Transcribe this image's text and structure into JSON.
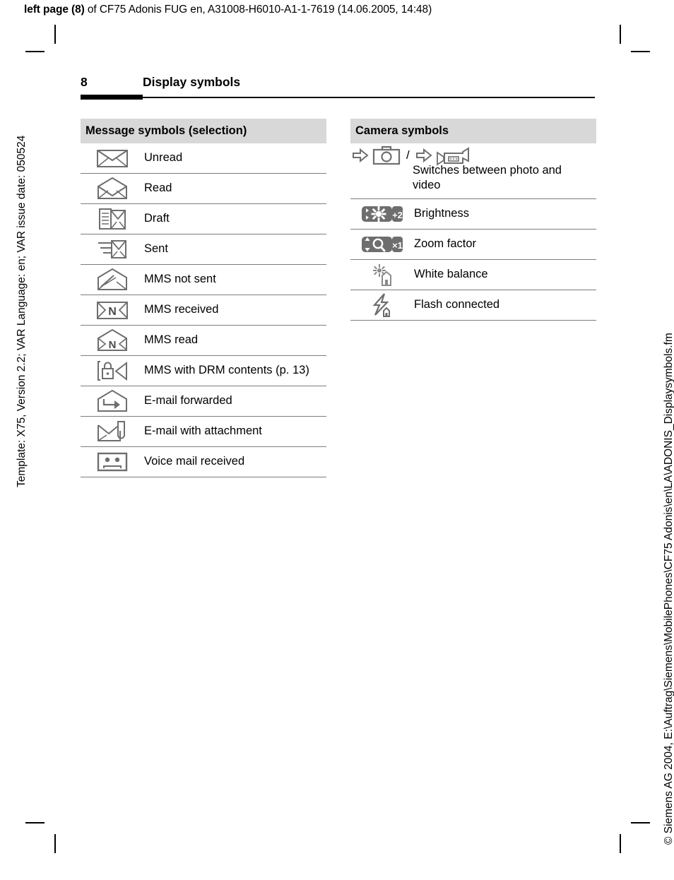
{
  "running_header": {
    "bold_prefix": "left page (8)",
    "rest": " of CF75 Adonis FUG en, A31008-H6010-A1-1-7619 (14.06.2005, 14:48)"
  },
  "side_text": {
    "left": "Template: X75, Version 2.2; VAR Language: en; VAR issue date: 050524",
    "right": "© Siemens AG 2004, E:\\Auftrag\\Siemens\\MobilePhones\\CF75 Adonis\\en\\LA\\ADONIS_Displaysymbols.fm"
  },
  "title": {
    "page_number": "8",
    "heading": "Display symbols"
  },
  "tables": [
    {
      "id": "message",
      "header": "Message symbols (selection)",
      "rows": [
        {
          "icon": "envelope-closed-icon",
          "label": "Unread"
        },
        {
          "icon": "envelope-open-icon",
          "label": "Read"
        },
        {
          "icon": "envelope-draft-icon",
          "label": "Draft"
        },
        {
          "icon": "envelope-sent-icon",
          "label": "Sent"
        },
        {
          "icon": "mms-not-sent-icon",
          "label": "MMS not sent"
        },
        {
          "icon": "mms-received-icon",
          "label": "MMS received"
        },
        {
          "icon": "mms-read-icon",
          "label": "MMS read"
        },
        {
          "icon": "mms-drm-icon",
          "label": "MMS with DRM contents (p. 13)"
        },
        {
          "icon": "email-forwarded-icon",
          "label": "E-mail forwarded"
        },
        {
          "icon": "email-attachment-icon",
          "label": "E-mail with attachment"
        },
        {
          "icon": "voice-mail-icon",
          "label": "Voice mail received"
        }
      ]
    },
    {
      "id": "camera",
      "header": "Camera symbols",
      "rows": [
        {
          "icon": "photo-video-switch-icon",
          "label": "Switches between photo and video",
          "separator": "/"
        },
        {
          "icon": "brightness-icon",
          "label": "Brightness",
          "badge": "+2"
        },
        {
          "icon": "zoom-factor-icon",
          "label": "Zoom factor",
          "badge": "×1"
        },
        {
          "icon": "white-balance-icon",
          "label": "White balance"
        },
        {
          "icon": "flash-connected-icon",
          "label": "Flash connected"
        }
      ]
    }
  ],
  "colors": {
    "header_fill": "#d8d8d8",
    "rule": "#7d7d7d",
    "icon_stroke": "#6e6e6e",
    "badge_fill": "#6e6e6e"
  }
}
